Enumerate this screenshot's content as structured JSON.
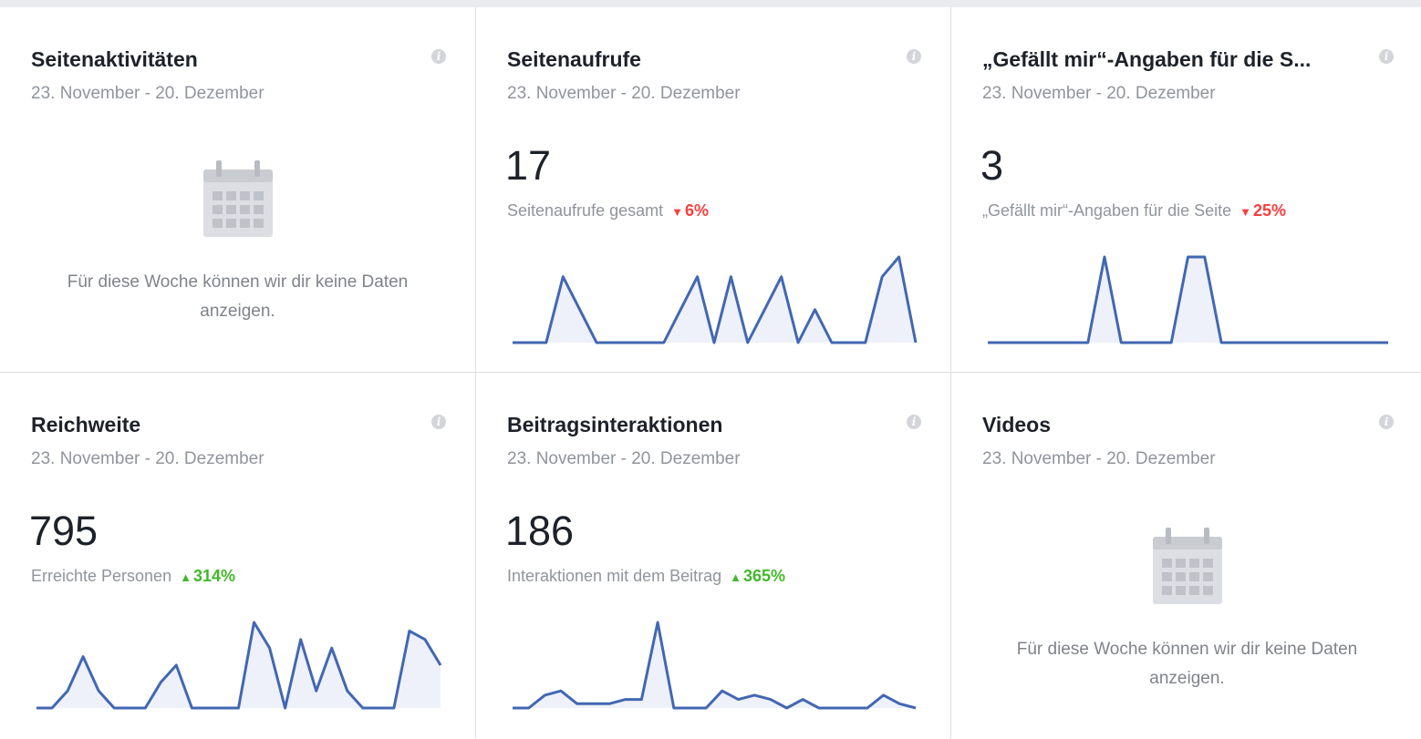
{
  "date_range": "23. November - 20. Dezember",
  "no_data_text": "Für diese Woche können wir dir keine Daten anzeigen.",
  "colors": {
    "line": "#4267b2",
    "fill": "#eef1fa",
    "down": "#fa3e3e",
    "up": "#42b72a"
  },
  "cards": [
    {
      "title": "Seitenaktivitäten"
    },
    {
      "title": "Seitenaufrufe",
      "value": "17",
      "metric_label": "Seitenaufrufe gesamt",
      "delta": "6%",
      "trend": "down",
      "series": [
        0,
        0,
        0,
        1,
        0.5,
        0,
        0,
        0,
        0,
        0,
        0.5,
        1,
        0,
        1,
        0,
        0.5,
        1,
        0,
        0.5,
        0,
        0,
        0,
        1,
        1.3,
        0
      ]
    },
    {
      "title": "„Gefällt mir“-Angaben für die S...",
      "value": "3",
      "metric_label": "„Gefällt mir“-Angaben für die Seite",
      "delta": "25%",
      "trend": "down",
      "series": [
        0,
        0,
        0,
        0,
        0,
        0,
        0,
        1,
        0,
        0,
        0,
        0,
        1,
        1,
        0,
        0,
        0,
        0,
        0,
        0,
        0,
        0,
        0,
        0,
        0
      ]
    },
    {
      "title": "Reichweite",
      "value": "795",
      "metric_label": "Erreichte Personen",
      "delta": "314%",
      "trend": "up",
      "series": [
        0,
        0,
        0.2,
        0.6,
        0.2,
        0,
        0,
        0,
        0.3,
        0.5,
        0,
        0,
        0,
        0,
        1,
        0.7,
        0,
        0.8,
        0.2,
        0.7,
        0.2,
        0,
        0,
        0,
        0.9,
        0.8,
        0.5
      ]
    },
    {
      "title": "Beitragsinteraktionen",
      "value": "186",
      "metric_label": "Interaktionen mit dem Beitrag",
      "delta": "365%",
      "trend": "up",
      "series": [
        0,
        0,
        0.15,
        0.2,
        0.05,
        0.05,
        0.05,
        0.1,
        0.1,
        1,
        0,
        0,
        0,
        0.2,
        0.1,
        0.15,
        0.1,
        0,
        0.1,
        0,
        0,
        0,
        0,
        0.15,
        0.05,
        0
      ]
    },
    {
      "title": "Videos"
    }
  ]
}
